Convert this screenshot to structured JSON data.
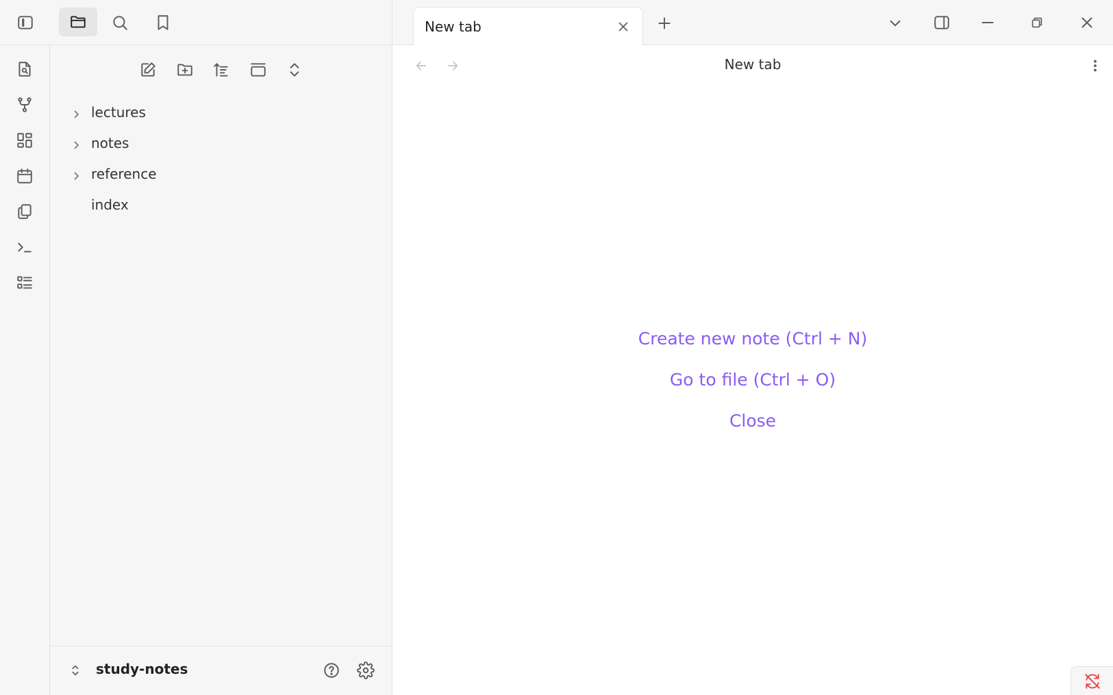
{
  "tab": {
    "title": "New tab"
  },
  "view": {
    "title": "New tab"
  },
  "explorer": {
    "items": [
      {
        "label": "lectures",
        "type": "folder"
      },
      {
        "label": "notes",
        "type": "folder"
      },
      {
        "label": "reference",
        "type": "folder"
      },
      {
        "label": "index",
        "type": "file"
      }
    ]
  },
  "vault": {
    "name": "study-notes"
  },
  "empty_state": {
    "create": "Create new note (Ctrl + N)",
    "goto": "Go to file (Ctrl + O)",
    "close": "Close"
  },
  "colors": {
    "accent": "#8a5cf5",
    "sync_error": "#e5484d"
  }
}
